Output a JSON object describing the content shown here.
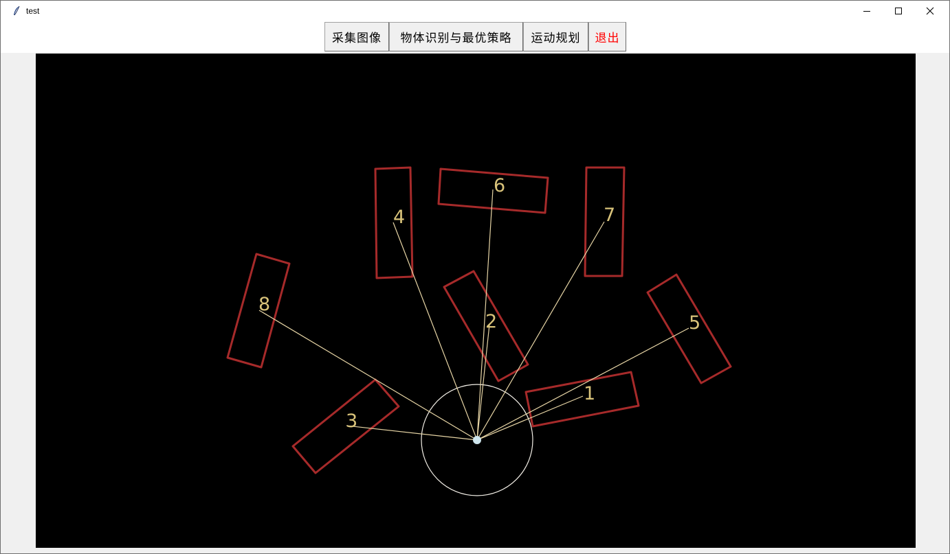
{
  "window": {
    "title": "test"
  },
  "toolbar": {
    "buttons": [
      {
        "label": "采集图像"
      },
      {
        "label": "物体识别与最优策略"
      },
      {
        "label": "运动规划"
      },
      {
        "label": "退出",
        "color": "#ff0000"
      }
    ]
  },
  "scene": {
    "background": "#000000",
    "box_color": "#a62a2a",
    "line_color": "#e8d6a6",
    "label_color": "#d9c37a",
    "objects": [
      {
        "label": "1"
      },
      {
        "label": "2"
      },
      {
        "label": "3"
      },
      {
        "label": "4"
      },
      {
        "label": "5"
      },
      {
        "label": "6"
      },
      {
        "label": "7"
      },
      {
        "label": "8"
      }
    ]
  }
}
